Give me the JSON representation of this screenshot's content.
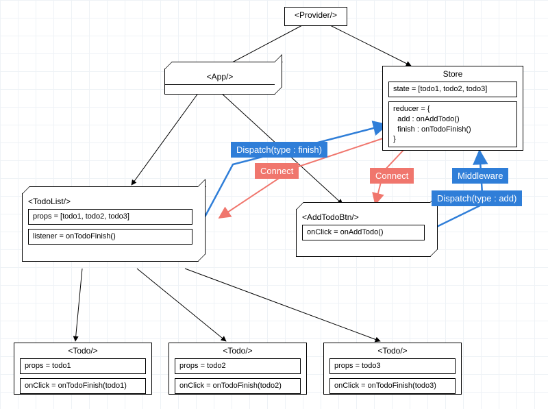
{
  "nodes": {
    "provider": {
      "title": "<Provider/>"
    },
    "app": {
      "title": "<App/>"
    },
    "store": {
      "title": "Store",
      "state": "state = [todo1, todo2, todo3]",
      "reducer": "reducer = {\n  add : onAddTodo()\n  finish : onTodoFinish()\n}"
    },
    "todoList": {
      "title": "<TodoList/>",
      "props": "props = [todo1, todo2, todo3]",
      "listener": "listener = onTodoFinish()"
    },
    "addTodoBtn": {
      "title": "<AddTodoBtn/>",
      "onClick": "onClick = onAddTodo()"
    },
    "todo1": {
      "title": "<Todo/>",
      "props": "props = todo1",
      "onClick": "onClick = onTodoFinish(todo1)"
    },
    "todo2": {
      "title": "<Todo/>",
      "props": "props = todo2",
      "onClick": "onClick = onTodoFinish(todo2)"
    },
    "todo3": {
      "title": "<Todo/>",
      "props": "props = todo3",
      "onClick": "onClick = onTodoFinish(todo3)"
    }
  },
  "labels": {
    "dispatchFinish": "Dispatch(type : finish)",
    "connect1": "Connect",
    "connect2": "Connect",
    "middleware": "Middleware",
    "dispatchAdd": "Dispatch(type : add)"
  }
}
